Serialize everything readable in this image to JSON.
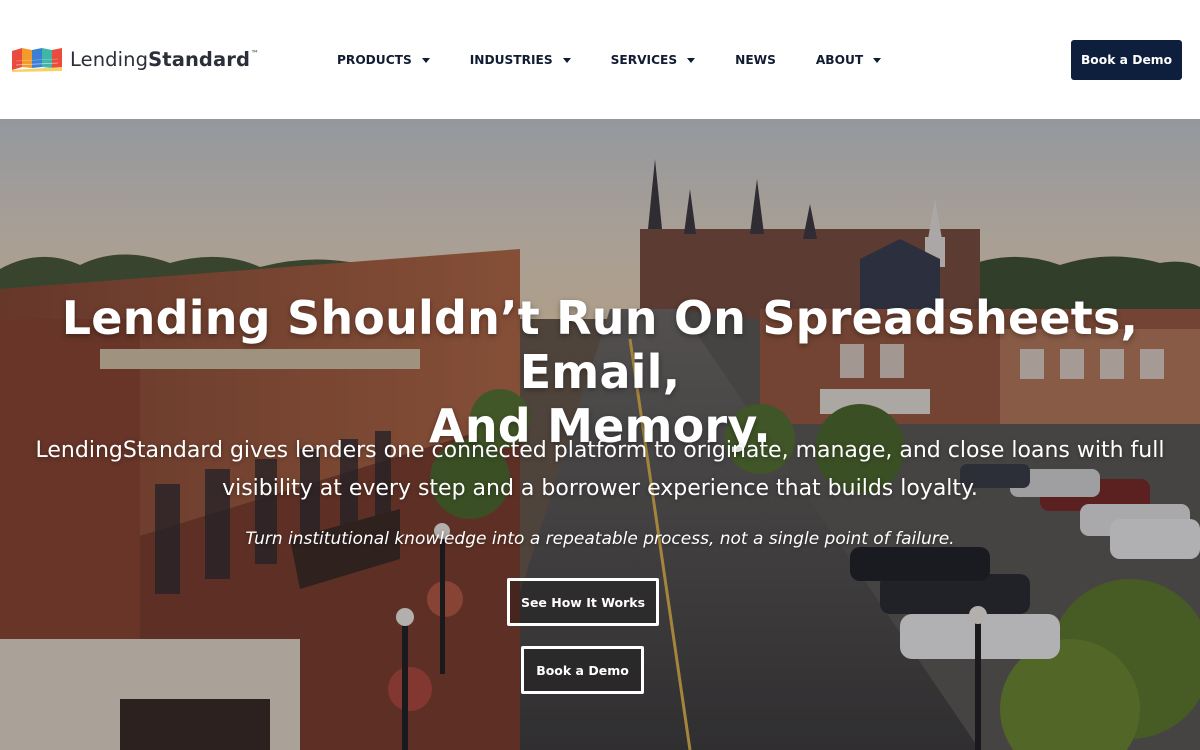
{
  "brand": {
    "name_light": "Lending",
    "name_bold": "Standard",
    "trademark": "™",
    "logo_colors": [
      "#e94b3c",
      "#f39a2c",
      "#f5c94a",
      "#3fb6a8",
      "#3b7fd4"
    ]
  },
  "nav": {
    "items": [
      {
        "label": "PRODUCTS",
        "has_dropdown": true
      },
      {
        "label": "INDUSTRIES",
        "has_dropdown": true
      },
      {
        "label": "SERVICES",
        "has_dropdown": true
      },
      {
        "label": "NEWS",
        "has_dropdown": false
      },
      {
        "label": "ABOUT",
        "has_dropdown": true
      }
    ],
    "cta_label": "Book a Demo"
  },
  "hero": {
    "title_line1": "Lending Shouldn’t Run On Spreadsheets, Email,",
    "title_line2": "And Memory.",
    "subtitle_line1": "LendingStandard gives lenders one connected platform to originate, manage, and close loans with full",
    "subtitle_line2": "visibility at every step and a borrower experience that builds loyalty.",
    "tagline": "Turn institutional knowledge into a repeatable process, not a single point of failure.",
    "primary_button": "See How It Works",
    "secondary_button": "Book a Demo"
  },
  "colors": {
    "navy": "#0d1f3c",
    "nav_text": "#111c33",
    "white": "#ffffff"
  }
}
